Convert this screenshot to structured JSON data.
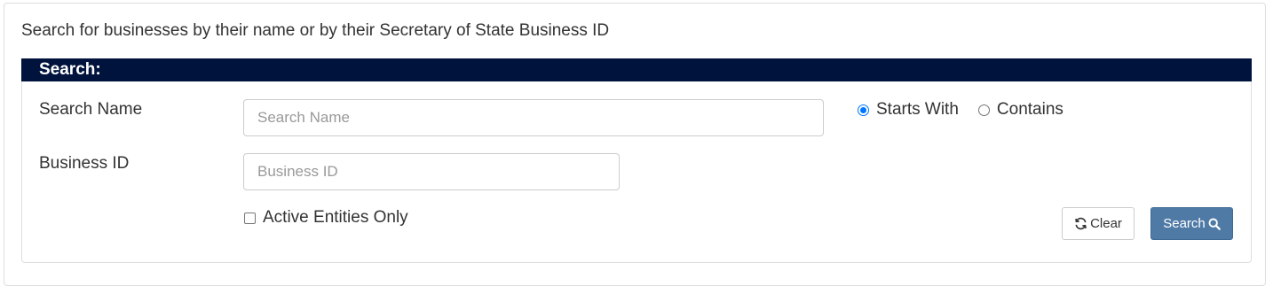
{
  "intro_text": "Search for businesses by their name or by their Secretary of State Business ID",
  "search_header": "Search:",
  "search_name": {
    "label": "Search Name",
    "placeholder": "Search Name",
    "value": ""
  },
  "business_id": {
    "label": "Business ID",
    "placeholder": "Business ID",
    "value": ""
  },
  "match_mode": {
    "options": [
      {
        "label": "Starts With",
        "checked": true
      },
      {
        "label": "Contains",
        "checked": false
      }
    ]
  },
  "active_only": {
    "label": "Active Entities Only",
    "checked": false
  },
  "buttons": {
    "clear": {
      "label": "Clear",
      "icon": "refresh-icon"
    },
    "search": {
      "label": "Search",
      "icon": "search-icon"
    }
  },
  "colors": {
    "header_bg": "#00133d",
    "search_button_bg": "#4f7aa6",
    "radio_accent": "#0075ff"
  }
}
